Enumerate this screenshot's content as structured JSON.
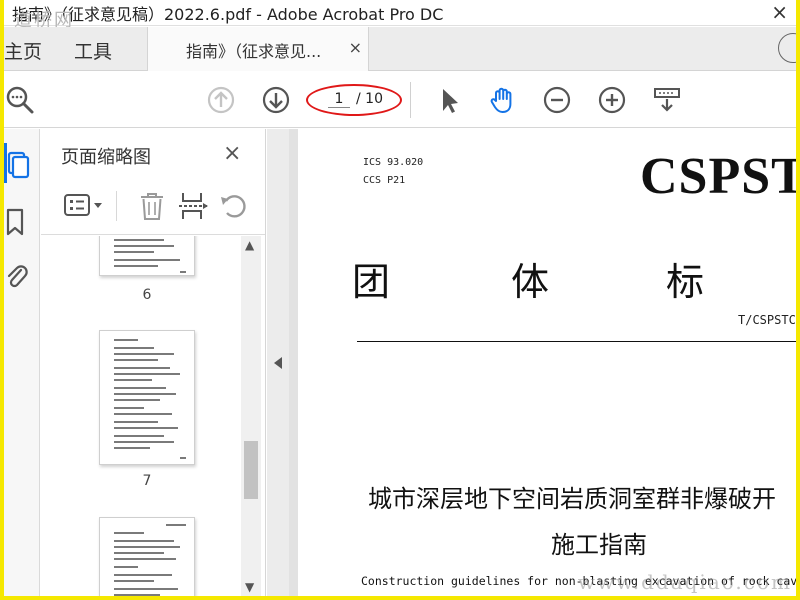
{
  "window": {
    "title": "指南》（征求意见稿）2022.6.pdf - Adobe Acrobat Pro DC",
    "watermark_left": "道桥网",
    "close_glyph": "×"
  },
  "tabs": {
    "home": "主页",
    "tools": "工具",
    "document": "指南》（征求意见...",
    "close_glyph": "×"
  },
  "toolbar": {
    "current_page": "1",
    "total_pages": "/ 10",
    "highlight_color": "#e01818",
    "active_tool": "hand-icon"
  },
  "left_rail": {
    "icons": [
      "page-thumbnails-icon",
      "bookmark-icon",
      "attachment-icon"
    ],
    "accent": "#1473e6"
  },
  "thumbnail_panel": {
    "title": "页面缩略图",
    "close_glyph": "×",
    "tools": [
      "options-menu-icon",
      "trash-icon",
      "insert-page-icon",
      "undo-icon"
    ],
    "pages": [
      {
        "number": "6"
      },
      {
        "number": "7"
      },
      {
        "number": ""
      }
    ]
  },
  "document": {
    "ics": "ICS 93.020",
    "ccs": "CCS P21",
    "brand": "CSPST",
    "heading_chars": [
      "团",
      "体",
      "标"
    ],
    "standard_no": "T/CSPSTC",
    "title_line1": "城市深层地下空间岩质洞室群非爆破开",
    "title_line2": "施工指南",
    "title_en": "Construction guidelines for non-blasting excavation of rock cave",
    "watermark": "www.ddaqiao.com"
  }
}
